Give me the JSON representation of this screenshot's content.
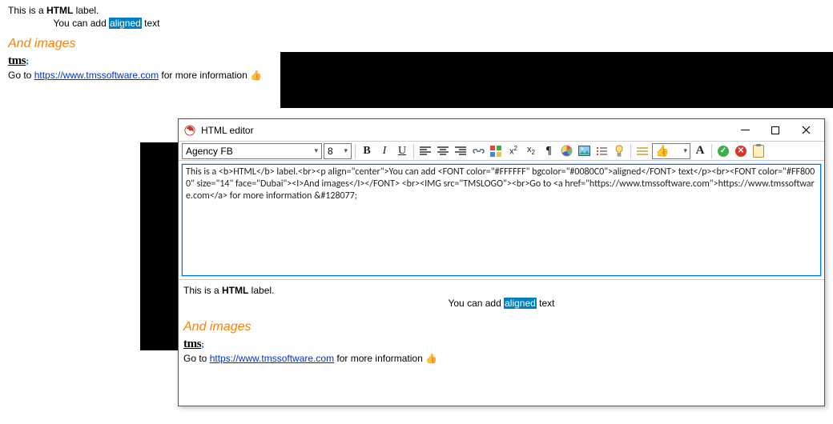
{
  "bg": {
    "line1_pre": "This is a ",
    "line1_bold": "HTML",
    "line1_post": " label.",
    "line2_pre": "You can add ",
    "line2_hi": "aligned",
    "line2_post": " text",
    "images_heading": "And images",
    "logo_text": "tms",
    "logo_semi": ";",
    "goto_pre": "Go to ",
    "goto_link": "https://www.tmssoftware.com",
    "goto_post": " for more information ",
    "thumb_emoji": "👍"
  },
  "window": {
    "title": "HTML editor"
  },
  "toolbar": {
    "font_name": "Agency FB",
    "font_size": "8",
    "hint_emoji": "👍"
  },
  "source_text": "This is a <b>HTML</b> label.<br><p align=\"center\">You can add <FONT color=\"#FFFFFF\" bgcolor=\"#0080C0\">aligned</FONT> text</p><br><FONT color=\"#FF8000\" size=\"14\" face=\"Dubai\"><I>And images</I></FONT> <br><IMG src=\"TMSLOGO\"><br>Go to <a href=\"https://www.tmssoftware.com\">https://www.tmssoftware.com</a> for more information &#128077;",
  "preview": {
    "line1_pre": "This is a ",
    "line1_bold": "HTML",
    "line1_post": " label.",
    "line2_pre": "You can add ",
    "line2_hi": "aligned",
    "line2_post": " text",
    "images_heading": "And images",
    "logo_text": "tms",
    "logo_semi": ";",
    "goto_pre": "Go to ",
    "goto_link": "https://www.tmssoftware.com",
    "goto_post": " for more information ",
    "thumb_emoji": "👍"
  }
}
